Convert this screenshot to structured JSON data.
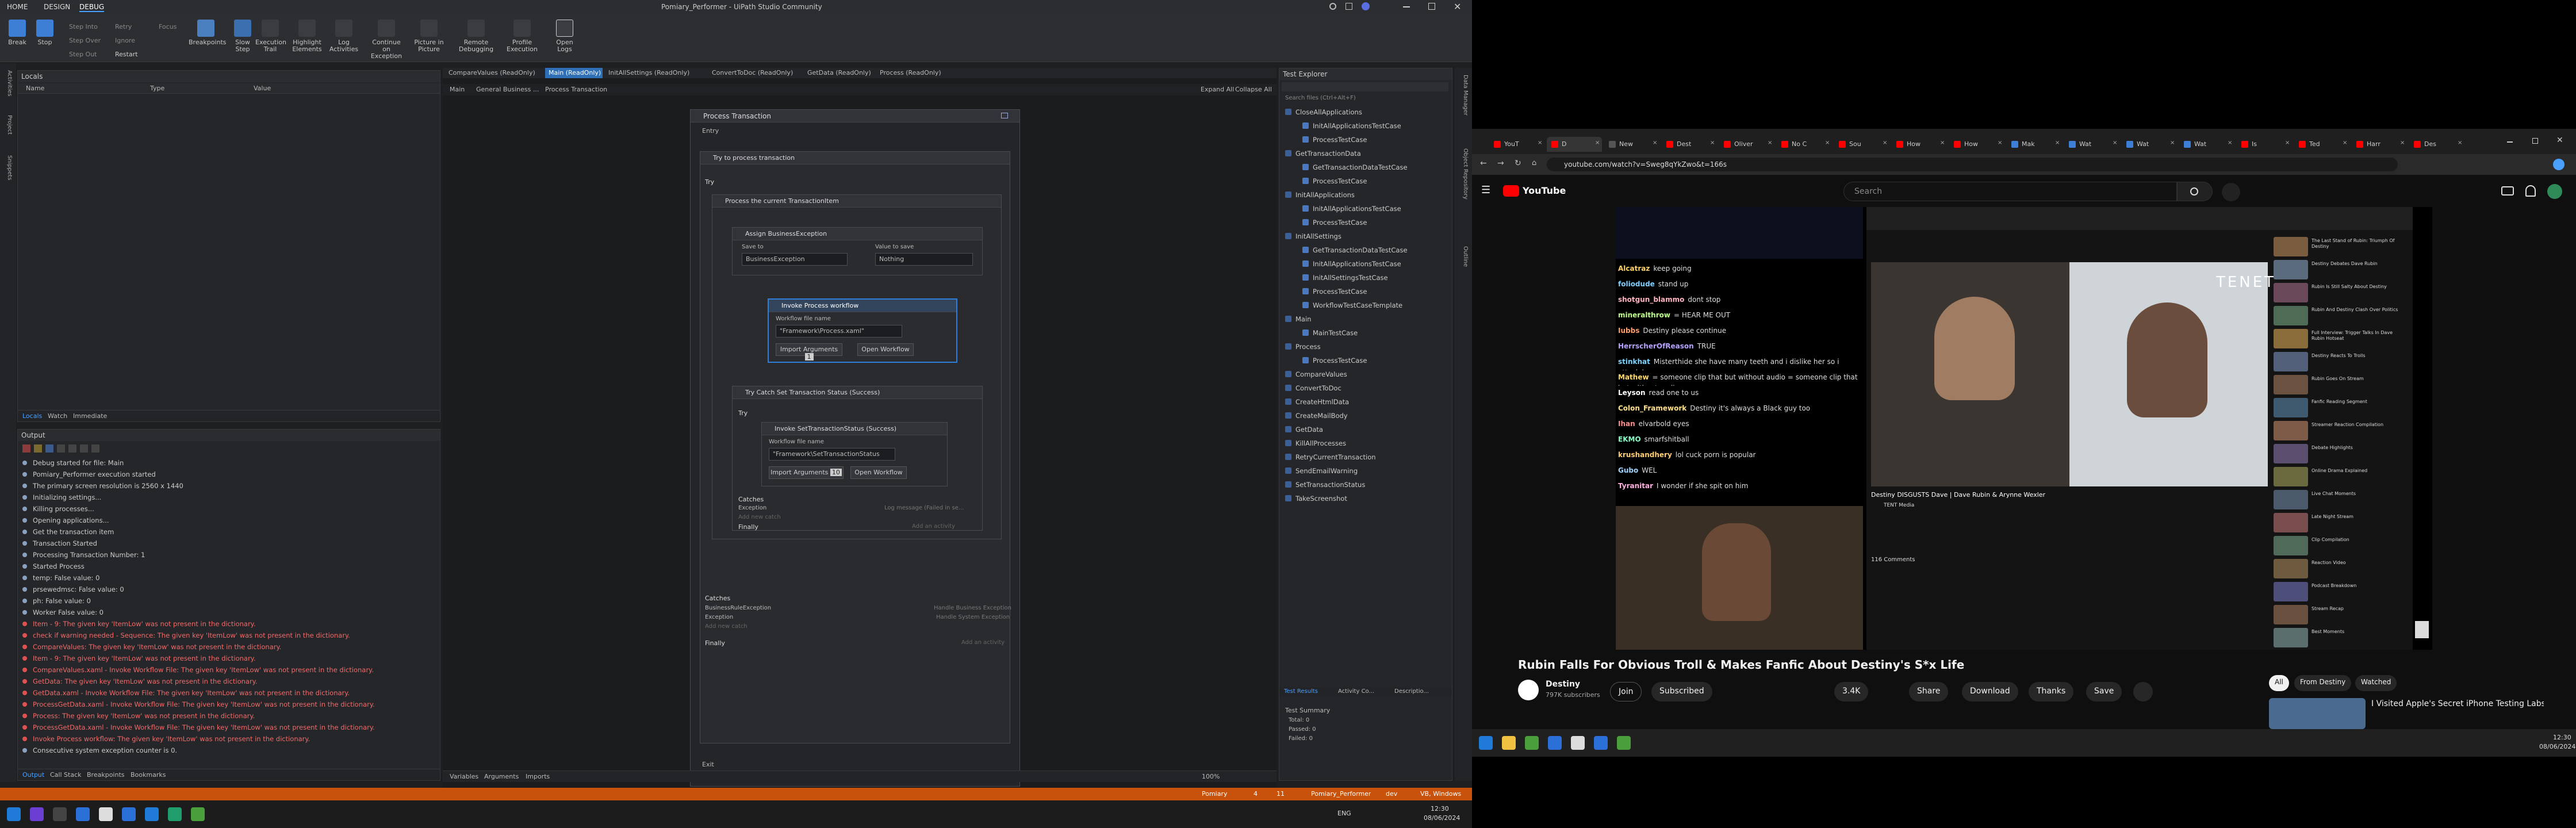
{
  "uipath": {
    "title": "Pomiary_Performer - UiPath Studio Community",
    "menu": [
      "HOME",
      "DESIGN",
      "DEBUG"
    ],
    "ribbon": {
      "break": "Break",
      "stop": "Stop",
      "step_into": "Step Into",
      "step_over": "Step Over",
      "step_out": "Step Out",
      "retry": "Retry",
      "ignore": "Ignore",
      "restart": "Restart",
      "focus": "Focus",
      "breakpoints": "Breakpoints",
      "slow_step": "Slow Step",
      "execution_trail": "Execution Trail",
      "highlight_elements": "Highlight Elements",
      "log_activities": "Log Activities",
      "continue_on_exception": "Continue on Exception",
      "picture_in_picture": "Picture in Picture",
      "remote_debugging": "Remote Debugging",
      "profile_execution": "Profile Execution",
      "open_logs": "Open Logs"
    },
    "locals": {
      "title": "Locals",
      "columns": [
        "Name",
        "Type",
        "Value"
      ],
      "tabs": [
        "Locals",
        "Watch",
        "Immediate"
      ]
    },
    "output": {
      "title": "Output",
      "lines": [
        {
          "text": "Debug started for file: Main",
          "type": "info"
        },
        {
          "text": "Pomiary_Performer execution started",
          "type": "info"
        },
        {
          "text": "The primary screen resolution is 2560 x 1440",
          "type": "info"
        },
        {
          "text": "Initializing settings...",
          "type": "info"
        },
        {
          "text": "Killing processes...",
          "type": "info"
        },
        {
          "text": "Opening applications...",
          "type": "info"
        },
        {
          "text": "Get the transaction item",
          "type": "info"
        },
        {
          "text": "Transaction Started",
          "type": "info"
        },
        {
          "text": "Processing Transaction Number: 1",
          "type": "info"
        },
        {
          "text": "Started Process",
          "type": "info"
        },
        {
          "text": "temp: False value: 0",
          "type": "info"
        },
        {
          "text": "prsewedmsc: False value: 0",
          "type": "info"
        },
        {
          "text": "ph: False value: 0",
          "type": "info"
        },
        {
          "text": "Worker False value: 0",
          "type": "info"
        },
        {
          "text": "Item - 9: The given key 'ItemLow' was not present in the dictionary.",
          "type": "error"
        },
        {
          "text": "check if warning needed - Sequence: The given key 'ItemLow' was not present in the dictionary.",
          "type": "error"
        },
        {
          "text": "CompareValues: The given key 'ItemLow' was not present in the dictionary.",
          "type": "error"
        },
        {
          "text": "Item - 9: The given key 'ItemLow' was not present in the dictionary.",
          "type": "error"
        },
        {
          "text": "CompareValues.xaml - Invoke Workflow File: The given key 'ItemLow' was not present in the dictionary.",
          "type": "error"
        },
        {
          "text": "GetData: The given key 'ItemLow' was not present in the dictionary.",
          "type": "error"
        },
        {
          "text": "GetData.xaml - Invoke Workflow File: The given key 'ItemLow' was not present in the dictionary.",
          "type": "error"
        },
        {
          "text": "ProcessGetData.xaml - Invoke Workflow File: The given key 'ItemLow' was not present in the dictionary.",
          "type": "error"
        },
        {
          "text": "Process: The given key 'ItemLow' was not present in the dictionary.",
          "type": "error"
        },
        {
          "text": "ProcessGetData.xaml - Invoke Workflow File: The given key 'ItemLow' was not present in the dictionary.",
          "type": "error"
        },
        {
          "text": "Invoke Process workflow: The given key 'ItemLow' was not present in the dictionary.",
          "type": "error"
        },
        {
          "text": "Consecutive system exception counter is 0.",
          "type": "info"
        }
      ],
      "tabs": [
        "Output",
        "Call Stack",
        "Breakpoints",
        "Bookmarks"
      ]
    },
    "doc_tabs": [
      "CompareValues (ReadOnly)",
      "Main (ReadOnly)",
      "InitAllSettings (ReadOnly)",
      "ConvertToDoc (ReadOnly)",
      "GetData (ReadOnly)",
      "Process (ReadOnly)"
    ],
    "breadcrumb": [
      "Main",
      "General Business ...",
      "Process Transaction"
    ],
    "expand_all": "Expand All",
    "collapse_all": "Collapse All",
    "designer": {
      "process_transaction": "Process Transaction",
      "entry": "Entry",
      "try_process": "Try to process transaction",
      "try": "Try",
      "process_current": "Process the current TransactionItem",
      "assign_be": "Assign BusinessException",
      "save_to": "Save to",
      "value_to_save": "Value to save",
      "business_exception": "BusinessException",
      "nothing": "Nothing",
      "invoke_process": "Invoke Process workflow",
      "workflow_file_name": "Workflow file name",
      "process_path": "\"Framework\\Process.xaml\"",
      "import_arguments": "Import Arguments",
      "open_workflow": "Open Workflow",
      "try_catch_set": "Try Catch Set Transaction Status (Success)",
      "invoke_set_status": "Invoke SetTransactionStatus (Success)",
      "set_status_path": "\"Framework\\SetTransactionStatus",
      "catches": "Catches",
      "exception": "Exception",
      "log_message": "Log message (Failed in se...",
      "add_new_catch": "Add new catch",
      "finally": "Finally",
      "add_activity": "Add an activity",
      "business_rule_exception": "BusinessRuleException",
      "handle_business": "Handle Business Exception",
      "handle_system": "Handle System Exception",
      "exit": "Exit",
      "import_count_1": "1",
      "import_count_2": "10"
    },
    "bottom_tabs": [
      "Variables",
      "Arguments",
      "Imports"
    ],
    "zoom": "100%",
    "test_explorer": {
      "title": "Test Explorer",
      "search": "Search files (Ctrl+Alt+F)",
      "items": [
        {
          "label": "CloseAllApplications",
          "level": 0
        },
        {
          "label": "InitAllApplicationsTestCase",
          "level": 1
        },
        {
          "label": "ProcessTestCase",
          "level": 1
        },
        {
          "label": "GetTransactionData",
          "level": 0
        },
        {
          "label": "GetTransactionDataTestCase",
          "level": 1
        },
        {
          "label": "ProcessTestCase",
          "level": 1
        },
        {
          "label": "InitAllApplications",
          "level": 0
        },
        {
          "label": "InitAllApplicationsTestCase",
          "level": 1
        },
        {
          "label": "ProcessTestCase",
          "level": 1
        },
        {
          "label": "InitAllSettings",
          "level": 0
        },
        {
          "label": "GetTransactionDataTestCase",
          "level": 1
        },
        {
          "label": "InitAllApplicationsTestCase",
          "level": 1
        },
        {
          "label": "InitAllSettingsTestCase",
          "level": 1
        },
        {
          "label": "ProcessTestCase",
          "level": 1
        },
        {
          "label": "WorkflowTestCaseTemplate",
          "level": 1
        },
        {
          "label": "Main",
          "level": 0
        },
        {
          "label": "MainTestCase",
          "level": 1
        },
        {
          "label": "Process",
          "level": 0
        },
        {
          "label": "ProcessTestCase",
          "level": 1
        },
        {
          "label": "CompareValues",
          "level": 0
        },
        {
          "label": "ConvertToDoc",
          "level": 0
        },
        {
          "label": "CreateHtmlData",
          "level": 0
        },
        {
          "label": "CreateMailBody",
          "level": 0
        },
        {
          "label": "GetData",
          "level": 0
        },
        {
          "label": "KillAllProcesses",
          "level": 0
        },
        {
          "label": "RetryCurrentTransaction",
          "level": 0
        },
        {
          "label": "SendEmailWarning",
          "level": 0
        },
        {
          "label": "SetTransactionStatus",
          "level": 0
        },
        {
          "label": "TakeScreenshot",
          "level": 0
        }
      ],
      "bottom_tabs": [
        "Test Results",
        "Activity Co...",
        "Descriptio..."
      ],
      "summary_title": "Test Summary",
      "total": "Total: 0",
      "passed": "Passed: 0",
      "failed": "Failed: 0"
    },
    "side_tabs_left": [
      "Activities",
      "Project",
      "Snippets"
    ],
    "side_tabs_right": [
      "Data Manager",
      "Object Repository",
      "Outline"
    ],
    "status": {
      "branch": "Pomiary",
      "errors": "4",
      "warnings": "11",
      "project": "Pomiary_Performer",
      "dev": "dev",
      "env": "VB, Windows"
    }
  },
  "taskbar_left": {
    "time": "12:30",
    "date": "08/06/2024",
    "lang": "ENG"
  },
  "browser": {
    "tabs": [
      "YouT",
      "D",
      "New",
      "Dest",
      "Oliver",
      "No C",
      "Sou",
      "How",
      "How",
      "Mak",
      "Wat",
      "Wat",
      "Wat",
      "Is",
      "Ted",
      "Harr",
      "Des"
    ],
    "url": "youtube.com/watch?v=Sweg8qYkZwo&t=166s",
    "search_placeholder": "Search",
    "chat": [
      {
        "user": "Alcatraz",
        "msg": "keep going"
      },
      {
        "user": "foliodude",
        "msg": "stand up"
      },
      {
        "user": "shotgun_blammo",
        "msg": "dont stop"
      },
      {
        "user": "mineralthrow",
        "msg": "= HEAR ME OUT"
      },
      {
        "user": "Iubbs",
        "msg": "Destiny please continue"
      },
      {
        "user": "HerrscherOfReason",
        "msg": "TRUE"
      },
      {
        "user": "stinkhat",
        "msg": "Misterthide she have many teeth and i dislike her so i attack her appearance"
      },
      {
        "user": "Mathew",
        "msg": "= someone clip that but without audio = someone clip that but without audio"
      },
      {
        "user": "Leyson",
        "msg": "read one to us"
      },
      {
        "user": "Colon_Framework",
        "msg": "Destiny it's always a Black guy too"
      },
      {
        "user": "Ihan",
        "msg": "elvarbold eyes"
      },
      {
        "user": "EKMO",
        "msg": "smarfshitball"
      },
      {
        "user": "krushandhery",
        "msg": "lol cuck porn is popular"
      },
      {
        "user": "Gubo",
        "msg": "WEL"
      },
      {
        "user": "Tyranitar",
        "msg": "I wonder if she spit on him"
      }
    ],
    "embedded_video_title": "Destiny DISGUSTS Dave | Dave Rubin & Arynne Wexler",
    "channel_small": "TENT Media",
    "comments_count": "116 Comments",
    "tenet": "TENET",
    "video_title": "Rubin Falls For Obvious Troll & Makes Fanfic About Destiny's S*x Life",
    "channel": "Destiny",
    "subscribers": "797K subscribers",
    "join": "Join",
    "subscribed": "Subscribed",
    "likes": "3.4K",
    "share": "Share",
    "download": "Download",
    "thanks": "Thanks",
    "save": "Save",
    "filters": [
      "All",
      "From Destiny",
      "Watched"
    ],
    "rec_title": "I Visited Apple's Secret iPhone Testing Labs!",
    "recommended": [
      "The Last Stand of Rubin: Triumph Of Destiny",
      "Destiny Debates Dave Rubin",
      "Rubin Is Still Salty About Destiny",
      "Rubin And Destiny Clash Over Politics",
      "Full Interview: Trigger Talks In Dave Rubin Hotseat",
      "Destiny Reacts To Trolls",
      "Rubin Goes On Stream",
      "Fanfic Reading Segment",
      "Streamer Reaction Compilation",
      "Debate Highlights",
      "Online Drama Explained",
      "Live Chat Moments",
      "Late Night Stream",
      "Clip Compilation",
      "Reaction Video",
      "Podcast Breakdown",
      "Stream Recap",
      "Best Moments"
    ]
  },
  "taskbar_right": {
    "time": "12:30",
    "date": "08/06/2024"
  }
}
